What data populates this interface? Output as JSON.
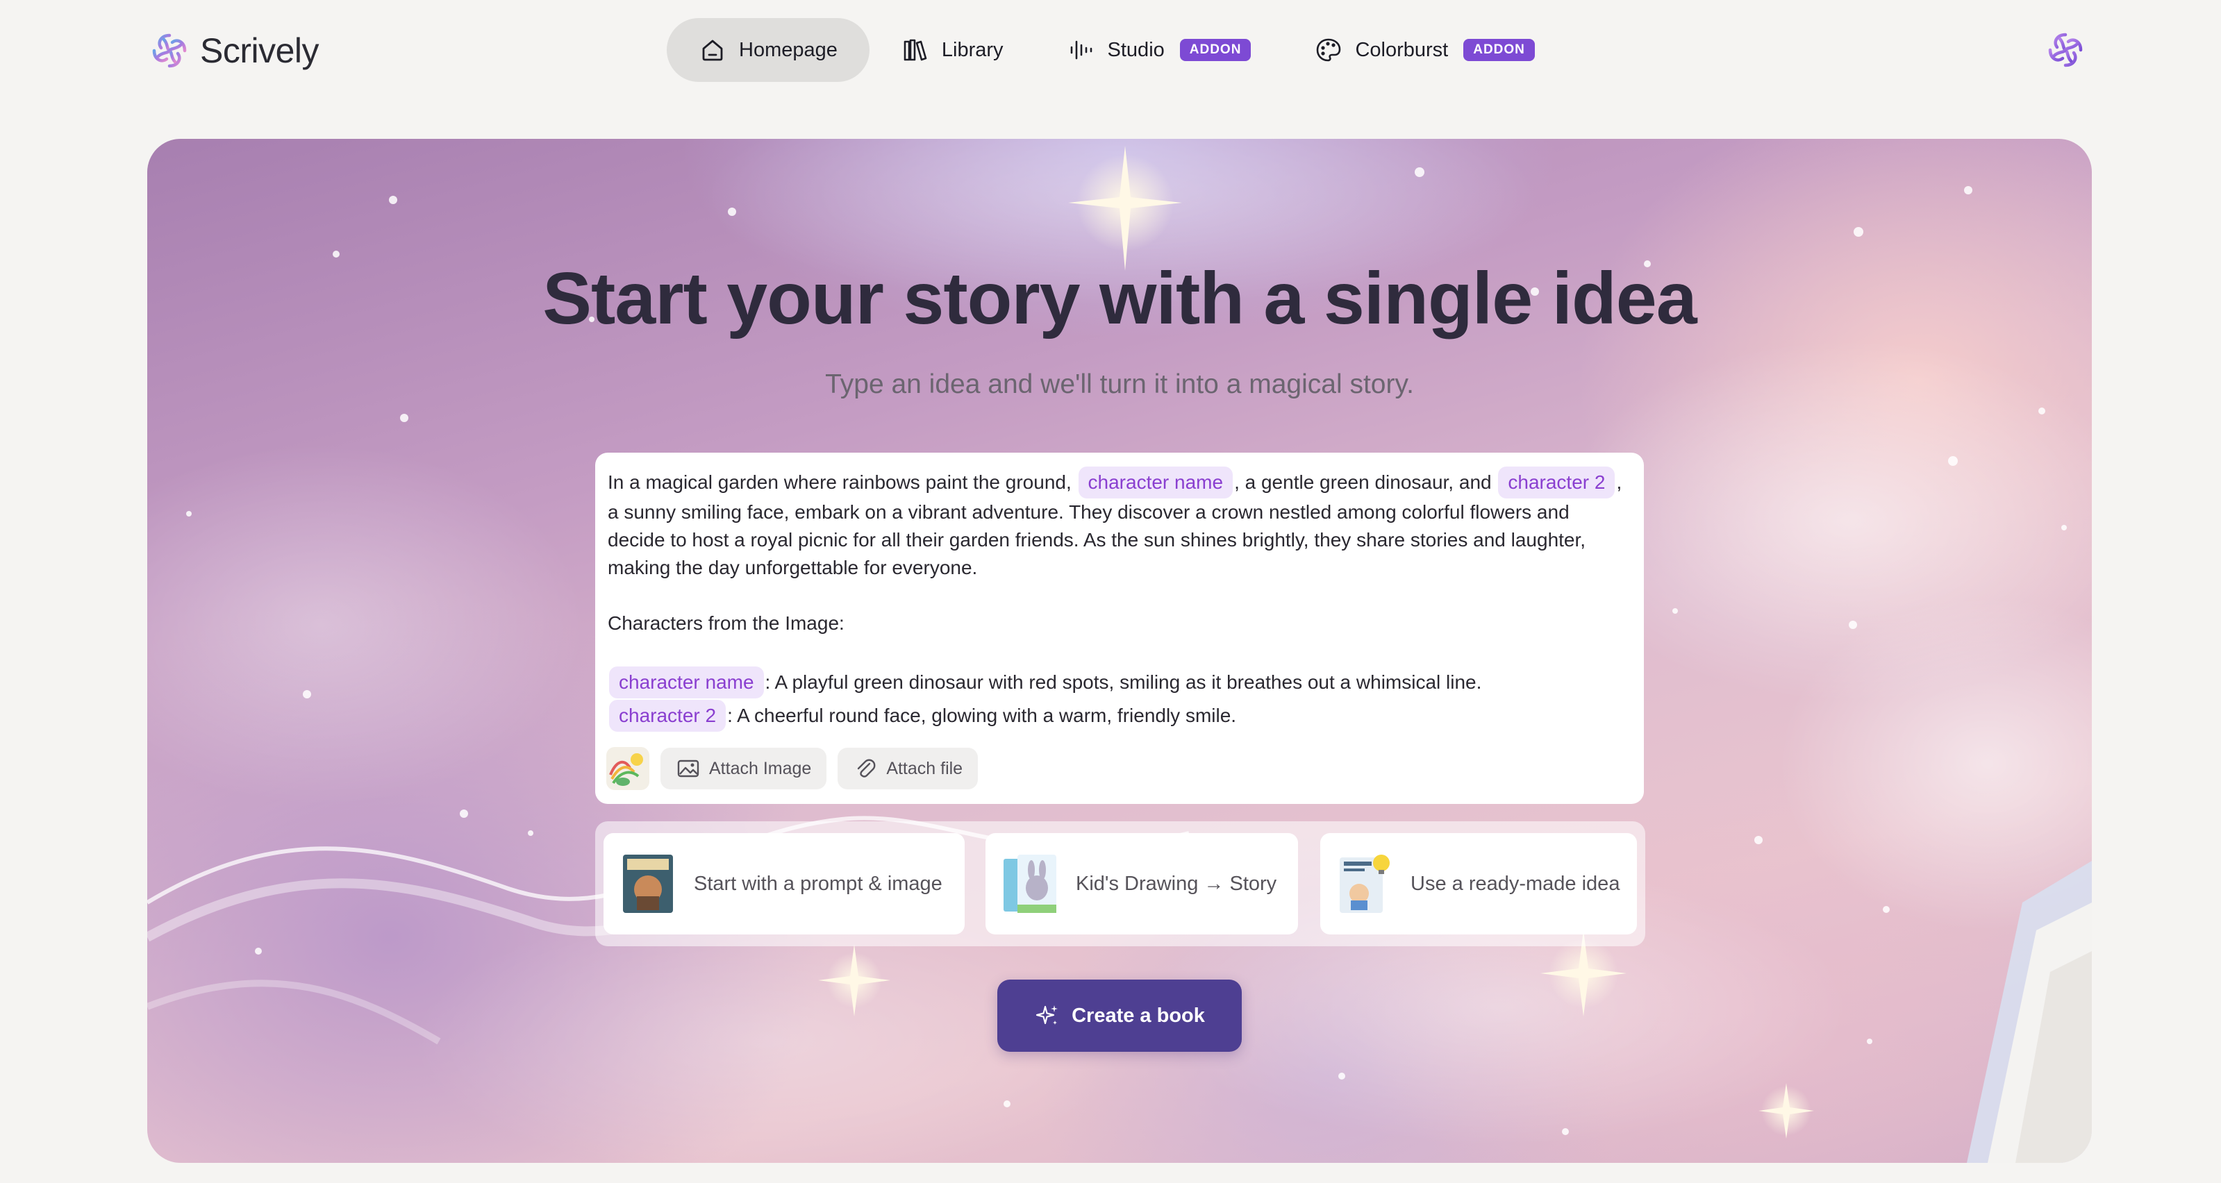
{
  "brand": {
    "name": "Scrively",
    "logo_icon": "swirl-logo-icon"
  },
  "nav": {
    "items": [
      {
        "label": "Homepage",
        "icon": "home-icon",
        "active": true,
        "badge": ""
      },
      {
        "label": "Library",
        "icon": "books-icon",
        "active": false,
        "badge": ""
      },
      {
        "label": "Studio",
        "icon": "audio-waveform-icon",
        "active": false,
        "badge": "ADDON"
      },
      {
        "label": "Colorburst",
        "icon": "palette-icon",
        "active": false,
        "badge": "ADDON"
      }
    ],
    "profile_icon": "swirl-avatar-icon"
  },
  "hero": {
    "title": "Start your story with a single idea",
    "subtitle": "Type an idea and we'll turn it into a magical story."
  },
  "prompt": {
    "part1": "In a magical garden where rainbows paint the ground,",
    "chip1": "character name",
    "part2": ", a gentle green dinosaur, and",
    "chip2": "character 2",
    "part3": ", a sunny smiling face, embark on a vibrant adventure. They discover a crown nestled among colorful flowers and decide to host a royal picnic for all their garden friends. As the sun shines brightly, they share stories and laughter, making the day unforgettable for everyone.",
    "characters_heading": "Characters from the Image:",
    "characters": [
      {
        "chip": "character name",
        "description": ": A playful green dinosaur with red spots, smiling as it breathes out a whimsical line."
      },
      {
        "chip": "character 2",
        "description": ": A cheerful round face, glowing with a warm, friendly smile."
      }
    ],
    "attach_image_label": "Attach Image",
    "attach_file_label": "Attach file"
  },
  "suggestions": [
    {
      "label": "Start with a prompt & image",
      "icon": "storybook-cover-icon"
    },
    {
      "label": "Kid's Drawing → Story",
      "icon": "bunny-book-icon"
    },
    {
      "label": "Use a ready-made idea",
      "icon": "idea-book-icon"
    }
  ],
  "create_button": {
    "label": "Create a book",
    "icon": "sparkle-icon"
  },
  "colors": {
    "accent": "#7d4ad4",
    "chip_bg": "#efe5fb",
    "chip_text": "#8a3fd0",
    "create_button": "#4e3f92",
    "page_bg": "#f5f4f2"
  }
}
